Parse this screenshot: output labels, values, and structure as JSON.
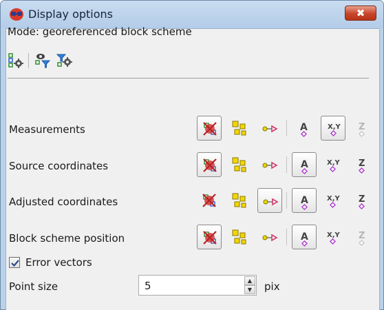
{
  "window": {
    "title": "Display options",
    "close_label": "✖"
  },
  "mode_text": "Mode: georeferenced block scheme",
  "toolbar_icons": [
    "block-settings-icon",
    "filter-view-icon",
    "filter-settings-icon"
  ],
  "rows": [
    {
      "label": "Measurements",
      "pressed": [
        "hide",
        "xy"
      ],
      "disabled": [
        "z"
      ]
    },
    {
      "label": "Source coordinates",
      "pressed": [
        "hide",
        "label"
      ],
      "disabled": []
    },
    {
      "label": "Adjusted coordinates",
      "pressed": [
        "vector",
        "label"
      ],
      "disabled": []
    },
    {
      "label": "Block scheme position",
      "pressed": [
        "hide",
        "label"
      ],
      "disabled": [
        "z"
      ]
    }
  ],
  "row_button_icons": [
    "hide-points-icon",
    "points-icon",
    "vectors-icon",
    "labels-icon",
    "xy-coordinates-icon",
    "z-coordinate-icon"
  ],
  "error_vectors": {
    "label": "Error vectors",
    "checked": true
  },
  "point_size": {
    "label": "Point size",
    "value": "5",
    "unit": "pix"
  }
}
